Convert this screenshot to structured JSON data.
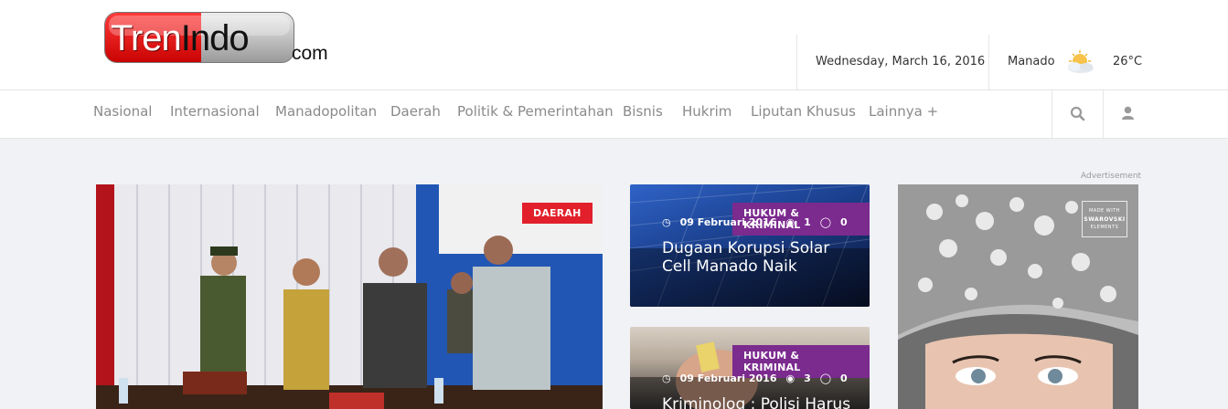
{
  "header": {
    "logo": {
      "part1": "Tren",
      "part2": "Indo",
      "suffix": "com"
    },
    "date": "Wednesday, March 16, 2016",
    "weather": {
      "city": "Manado",
      "icon": "partly-cloudy-sun-icon",
      "temperature": "26°C"
    }
  },
  "nav": {
    "items": [
      {
        "label": "Nasional"
      },
      {
        "label": "Internasional"
      },
      {
        "label": "Manadopolitan"
      },
      {
        "label": "Daerah"
      },
      {
        "label": "Politik & Pemerintahan"
      },
      {
        "label": "Bisnis"
      },
      {
        "label": "Hukrim"
      },
      {
        "label": "Liputan Khusus"
      },
      {
        "label": "Lainnya +"
      }
    ],
    "icons": [
      "search-icon",
      "user-icon"
    ]
  },
  "feature": {
    "category": "DAERAH",
    "category_color": "#e2202b"
  },
  "cards": [
    {
      "category": "HUKUM & KRIMINAL",
      "date": "09 Februari 2016",
      "views": "1",
      "comments": "0",
      "title": "Dugaan Korupsi Solar Cell Manado Naik"
    },
    {
      "category": "HUKUM & KRIMINAL",
      "date": "09 Februari 2016",
      "views": "3",
      "comments": "0",
      "title": "Kriminolog : Polisi Harus"
    }
  ],
  "ad": {
    "label": "Advertisement",
    "brand_line1": "MADE WITH",
    "brand_line2": "SWAROVSKI",
    "brand_line3": "ELEMENTS"
  },
  "colors": {
    "accent_red": "#e2202b",
    "accent_purple": "#7b2a8e",
    "nav_text": "#8a8a8a"
  }
}
